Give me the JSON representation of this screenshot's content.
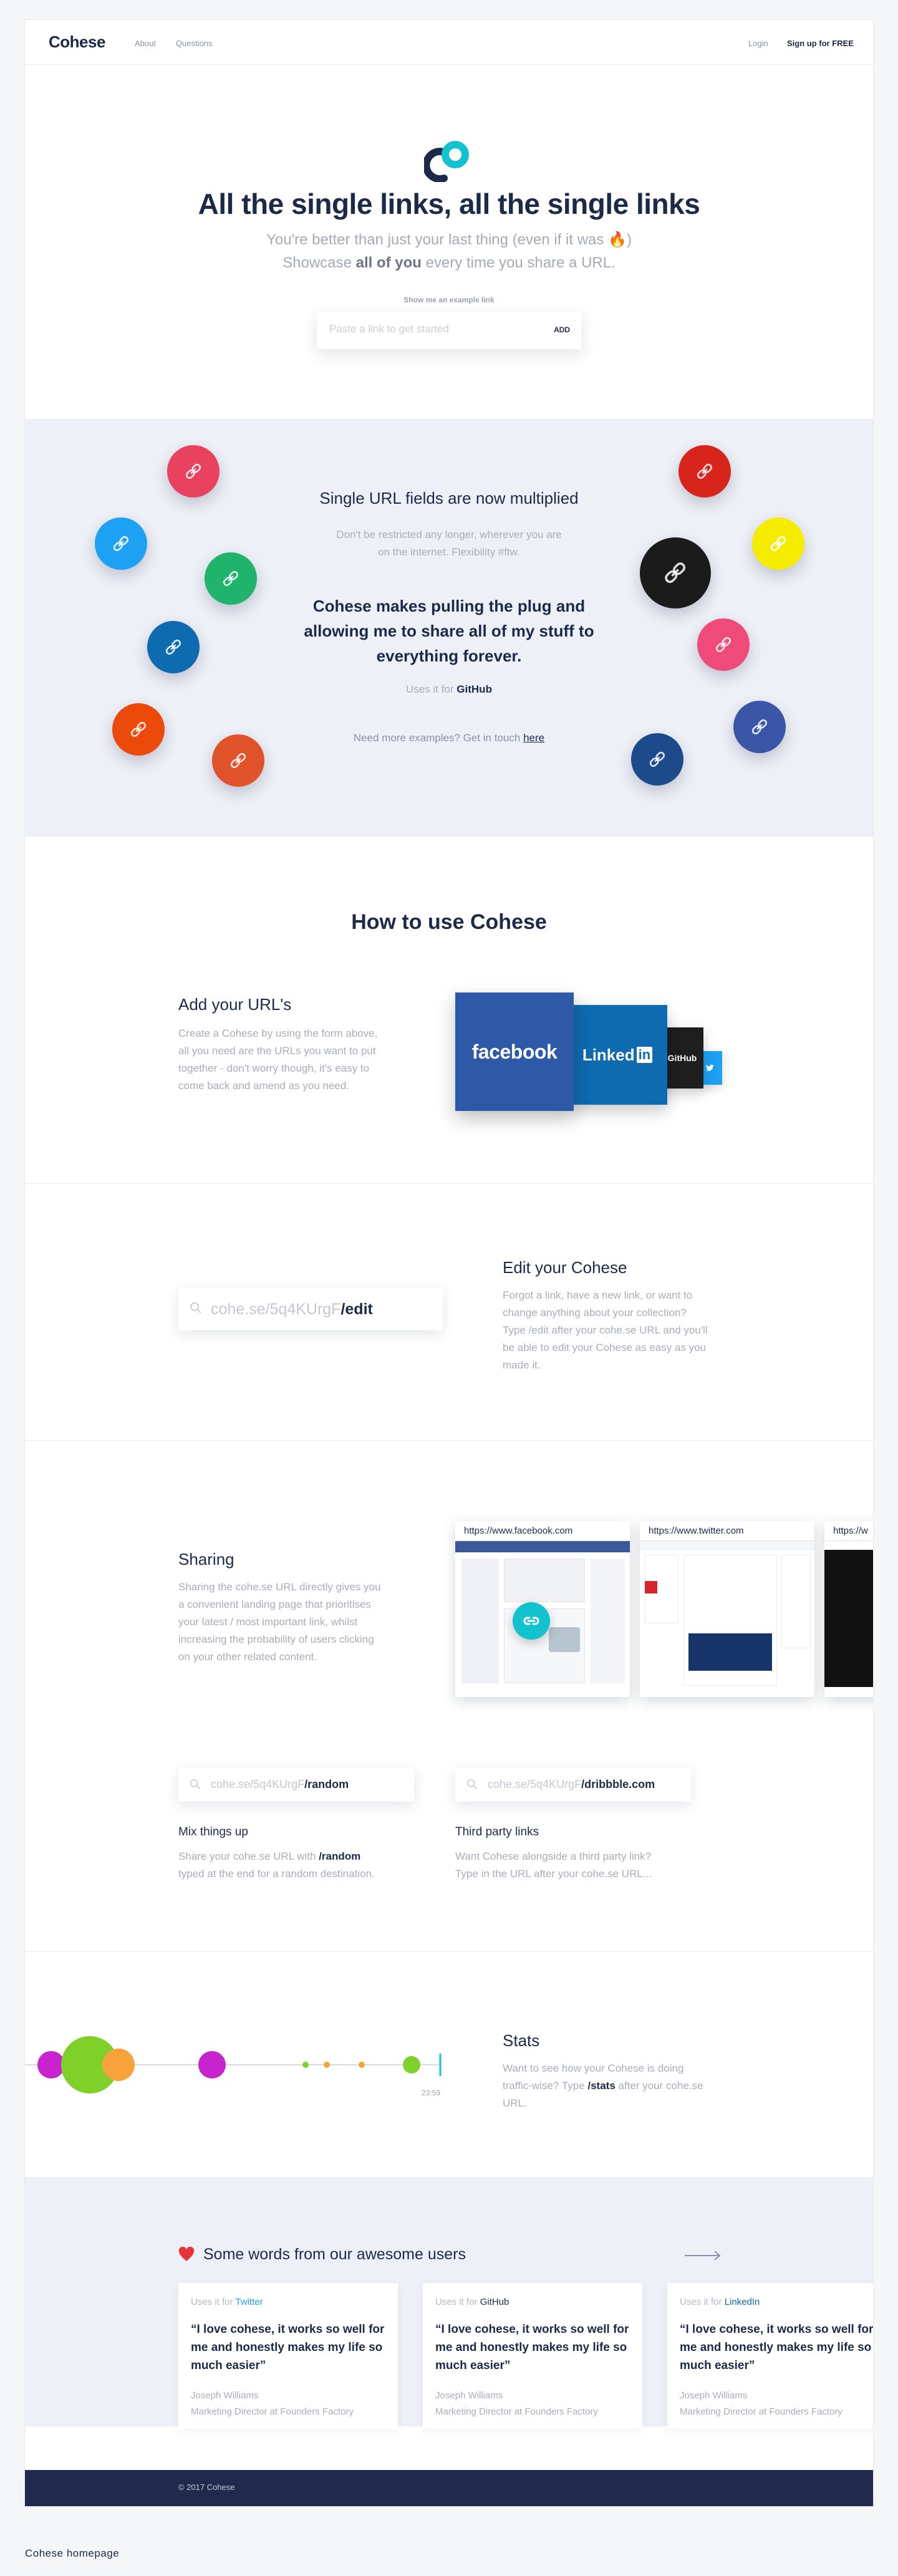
{
  "header": {
    "logo": "Cohese",
    "nav": [
      "About",
      "Questions"
    ],
    "login": "Login",
    "signup": "Sign up for FREE"
  },
  "hero": {
    "title": "All the single links, all the single links",
    "sub1": "You're better than just your last thing (even if it was 🔥)",
    "sub2_pre": "Showcase ",
    "sub2_bold": "all of you",
    "sub2_post": " every time you share a URL.",
    "example_label": "Show me an example link",
    "input_placeholder": "Paste a link to get started",
    "add_label": "ADD"
  },
  "features": {
    "title": "Single URL fields are now multiplied",
    "text_line1": "Don't be restricted any longer, wherever you are",
    "text_line2": "on the internet. Flexibility #ftw.",
    "quote_line1": "Cohese makes pulling the plug and",
    "quote_line2": "allowing me to share all of my stuff to",
    "quote_line3": "everything forever.",
    "uses_pre": "Uses it for ",
    "uses_name": "GitHub",
    "more_pre": "Need more examples? Get in touch ",
    "more_link": "here",
    "circle_colors": {
      "pink": "#e8425f",
      "blue": "#1da1f2",
      "green": "#1fb36b",
      "navy": "#0e6bb0",
      "orange": "#ec4a0a",
      "orange2": "#e0532a",
      "red": "#d8251c",
      "yellow": "#f6ec00",
      "black": "#1b1b1b",
      "rose": "#ee4a7a",
      "indigo": "#3b56a6",
      "darkblue": "#1d4a8a"
    }
  },
  "how": {
    "title": "How to use Cohese",
    "add": {
      "title": "Add your URL's",
      "l1": "Create a Cohese by using the form above,",
      "l2": "all you need are the URLs you want to put",
      "l3": "together - don't worry though, it's easy to",
      "l4": "come back and amend as you need.",
      "facebook": "facebook",
      "linkedin": "Linked",
      "linkedin_in": "in",
      "github": "GitHub"
    },
    "edit": {
      "field_pre": "cohe.se/5q4KUrgF",
      "field_suf": "/edit",
      "title": "Edit your Cohese",
      "l1": "Forgot a link, have a new link, or want to",
      "l2": "change anything about your collection?",
      "l3": "Type /edit after your cohe.se URL and you'll",
      "l4": "be able to edit your Cohese as easy as you",
      "l5": "made it."
    },
    "sharing": {
      "title": "Sharing",
      "l1": "Sharing the cohe.se URL directly gives you",
      "l2": "a convenient landing page that prioritises",
      "l3": "your latest / most important link, whilst",
      "l4": "increasing the probability of users clicking",
      "l5": "on your other related content.",
      "browsers": [
        "https://www.facebook.com",
        "https://www.twitter.com",
        "https://w"
      ]
    },
    "random": {
      "field_pre": "cohe.se/5q4KUrgF",
      "field_suf": "/random",
      "title": "Mix things up",
      "l1_pre": "Share your cohe.se URL with ",
      "l1_bold": "/random",
      "l2": "typed at the end for a random destination."
    },
    "third": {
      "field_pre": "cohe.se/5q4KUrgF",
      "field_suf": "/dribbble.com",
      "title": "Third party links",
      "l1": "Want Cohese alongside a third party link?",
      "l2": "Type in the URL after your cohe.se URL..."
    },
    "stats": {
      "title": "Stats",
      "l1": "Want to see how your Cohese is doing",
      "l2_pre": "traffic-wise? Type ",
      "l2_bold": "/stats",
      "l2_post": " after your cohe.se",
      "l3": "URL.",
      "time_label": "23:59"
    }
  },
  "testimonials": {
    "title": "Some words from our awesome users",
    "cards": [
      {
        "uses": "Uses it for ",
        "platform": "Twitter",
        "color": "#1da1f2",
        "quote": "“I love cohese, it works so well for me and honestly makes my life so much easier”",
        "name": "Joseph Williams",
        "role": "Marketing Director at Founders Factory"
      },
      {
        "uses": "Uses it for ",
        "platform": "GitHub",
        "color": "#1c2a4a",
        "quote": "“I love cohese, it works so well for me and honestly makes my life so much easier”",
        "name": "Joseph Williams",
        "role": "Marketing Director at Founders Factory"
      },
      {
        "uses": "Uses it for ",
        "platform": "LinkedIn",
        "color": "#0e6bb0",
        "quote": "“I love cohese, it works so well for me and honestly makes my life so much easier”",
        "name": "Joseph Williams",
        "role": "Marketing Director at Founders Factory"
      }
    ]
  },
  "footer": {
    "copyright": "© 2017 Cohese"
  },
  "caption": "Cohese homepage"
}
